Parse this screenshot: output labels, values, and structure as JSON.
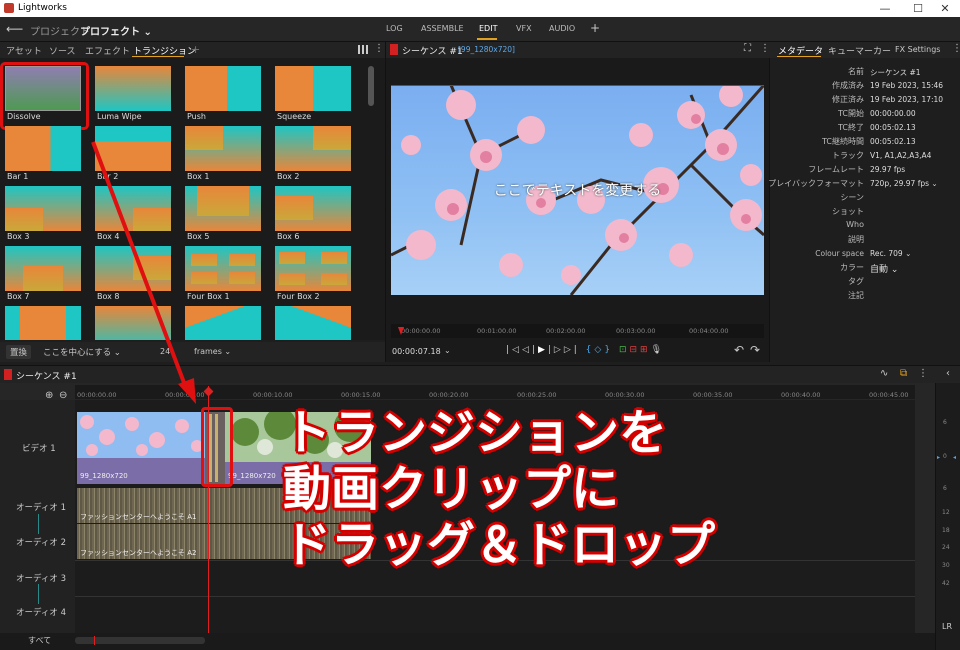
{
  "app": {
    "title": "Lightworks"
  },
  "window_buttons": [
    "—",
    "☐",
    "✕"
  ],
  "topbar": {
    "back": "⟵",
    "project_label": "プロジェクト",
    "project_name": "プロフェクト",
    "tabs": [
      "LOG",
      "ASSEMBLE",
      "EDIT",
      "VFX",
      "AUDIO"
    ],
    "active_tab": "EDIT",
    "add": "+"
  },
  "left_panel": {
    "tabs": [
      "アセット",
      "ソース",
      "エフェクト",
      "トランジション"
    ],
    "active_tab": "トランジション",
    "add": "+",
    "transitions": [
      "Dissolve",
      "Luma Wipe",
      "Push",
      "Squeeze",
      "Bar 1",
      "Bar 2",
      "Box 1",
      "Box 2",
      "Box 3",
      "Box 4",
      "Box 5",
      "Box 6",
      "Box 7",
      "Box 8",
      "Four Box 1",
      "Four Box 2"
    ],
    "bottom": {
      "replace": "置換",
      "center": "ここを中心にする ⌄",
      "frames_value": "24",
      "frames_unit": "frames ⌄"
    }
  },
  "viewer": {
    "title": "シーケンス #1",
    "subtitle": "[99_1280x720]",
    "caption": "ここでテキストを変更する",
    "timecodes": [
      "00:00:00.00",
      "00:01:00.00",
      "00:02:00.00",
      "00:03:00.00",
      "00:04:00.00"
    ],
    "current_time": "00:00:07.18"
  },
  "metadata_panel": {
    "tabs": [
      "メタデータ",
      "キューマーカー",
      "FX Settings"
    ],
    "active_tab": "メタデータ",
    "rows": [
      {
        "k": "名前",
        "v": "シーケンス #1"
      },
      {
        "k": "作成済み",
        "v": "19 Feb 2023, 15:46"
      },
      {
        "k": "修正済み",
        "v": "19 Feb 2023, 17:10"
      },
      {
        "k": "TC開始",
        "v": "00:00:00.00"
      },
      {
        "k": "TC終了",
        "v": "00:05:02.13"
      },
      {
        "k": "TC継続時間",
        "v": "00:05:02.13"
      },
      {
        "k": "トラック",
        "v": "V1, A1,A2,A3,A4"
      },
      {
        "k": "フレームレート",
        "v": "29.97 fps"
      },
      {
        "k": "プレイバックフォーマット",
        "v": "720p, 29.97 fps ⌄"
      },
      {
        "k": "シーン",
        "v": ""
      },
      {
        "k": "ショット",
        "v": ""
      },
      {
        "k": "Who",
        "v": ""
      },
      {
        "k": "説明",
        "v": ""
      },
      {
        "k": "Colour space",
        "v": "Rec. 709 ⌄"
      },
      {
        "k": "カラー",
        "v": "自動 ⌄"
      },
      {
        "k": "タグ",
        "v": ""
      },
      {
        "k": "注記",
        "v": ""
      }
    ]
  },
  "timeline": {
    "title": "シーケンス #1",
    "ruler": [
      "00:00:00.00",
      "00:00:05.00",
      "00:00:10.00",
      "00:00:15.00",
      "00:00:20.00",
      "00:00:25.00",
      "00:00:30.00",
      "00:00:35.00",
      "00:00:40.00",
      "00:00:45.00"
    ],
    "tracks": [
      "ビデオ 1",
      "オーディオ 1",
      "オーディオ 2",
      "オーディオ 3",
      "オーディオ 4"
    ],
    "clips": {
      "video1": "99_1280x720",
      "video2": "99_1280x720",
      "audio1": "ファッションセンターへようこそ A1",
      "audio2": "ファッションセンターへようこそ A2"
    },
    "all_label": "すべて",
    "meter_ticks": [
      "6",
      "0",
      "6",
      "12",
      "18",
      "24",
      "30",
      "42"
    ],
    "meter_footer": "LR"
  },
  "annotation": {
    "lines": [
      "トランジションを",
      "動画クリップに",
      "ドラッグ＆ドロップ"
    ],
    "color": "#e01010"
  }
}
